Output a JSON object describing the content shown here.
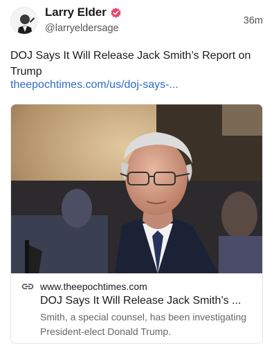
{
  "author": {
    "display_name": "Larry Elder",
    "handle": "@larryeldersage",
    "timestamp": "36m"
  },
  "post": {
    "text": "DOJ Says It Will Release Jack Smith’s Report on Trump",
    "link_text": "theepochtimes.com/us/doj-says-..."
  },
  "link_card": {
    "domain": "www.theepochtimes.com",
    "title": "DOJ Says It Will Release Jack Smith’s ...",
    "description": "Smith, a special counsel, has been investigating President-elect Donald Trump."
  },
  "colors": {
    "verified_badge": "#e8456b",
    "link": "#2f6bc5"
  },
  "icons": {
    "verified": "verified-badge-icon",
    "link": "link-chain-icon"
  }
}
